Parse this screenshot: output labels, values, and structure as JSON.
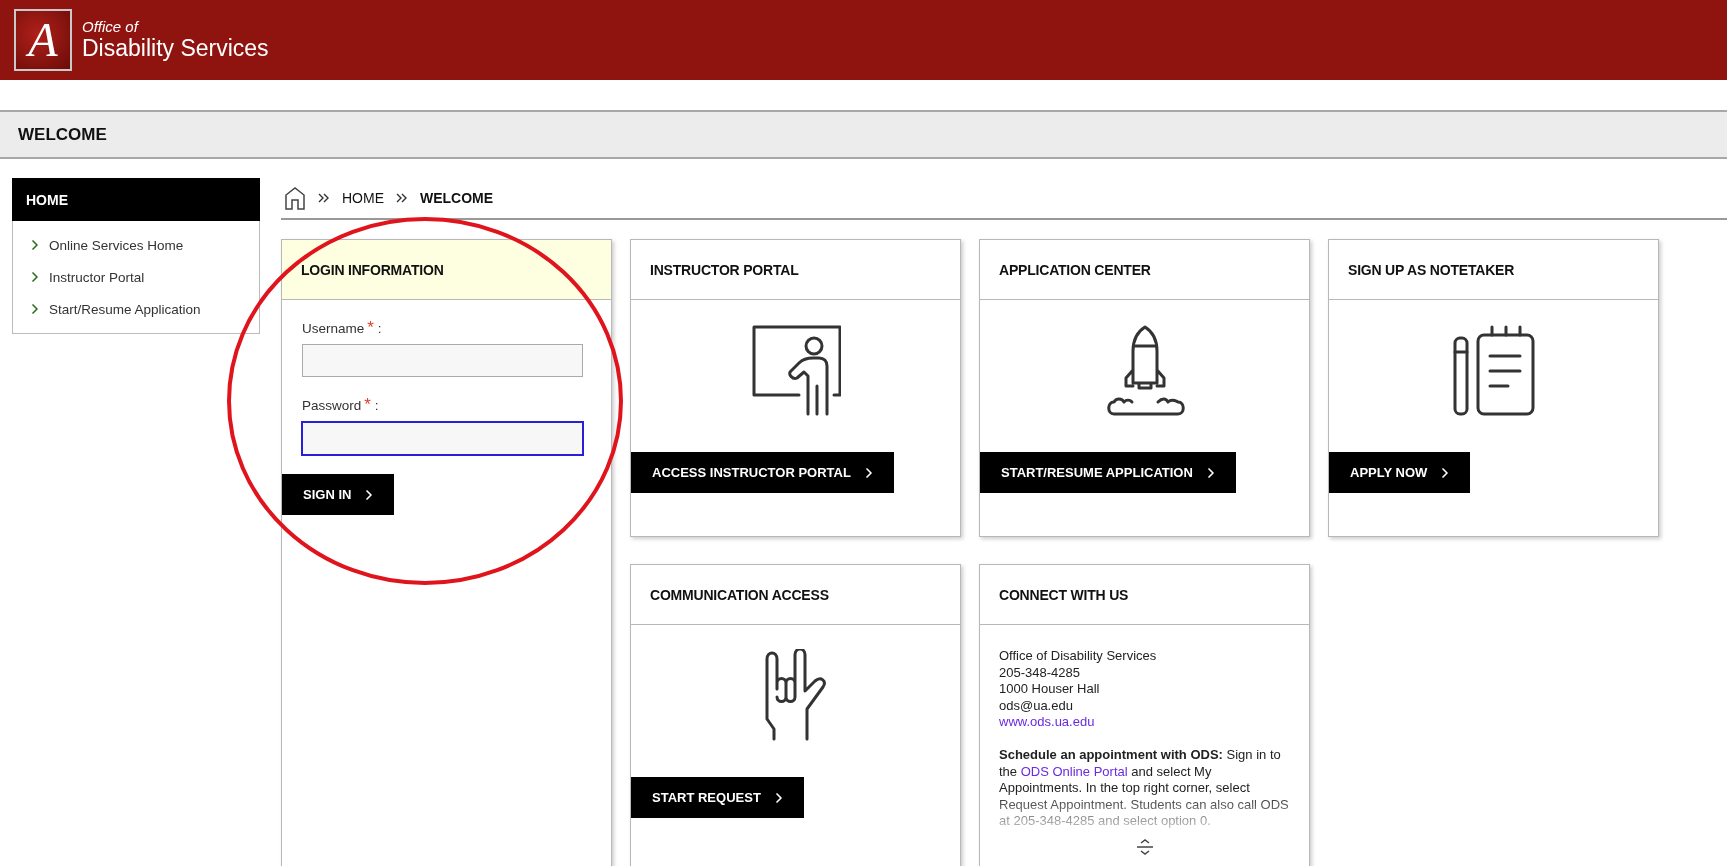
{
  "header": {
    "logo_letter": "A",
    "subtitle": "Office of",
    "title": "Disability Services"
  },
  "page_title": "WELCOME",
  "sidebar": {
    "heading": "HOME",
    "items": [
      {
        "label": "Online Services Home"
      },
      {
        "label": "Instructor Portal"
      },
      {
        "label": "Start/Resume Application"
      }
    ]
  },
  "breadcrumb": [
    {
      "label": "HOME",
      "current": false
    },
    {
      "label": "WELCOME",
      "current": true
    }
  ],
  "login": {
    "title": "LOGIN INFORMATION",
    "fields": [
      {
        "label": "Username",
        "required_mark": "*",
        "suffix": ":",
        "focused": false
      },
      {
        "label": "Password",
        "required_mark": "*",
        "suffix": ":",
        "focused": true
      }
    ],
    "button": "SIGN IN"
  },
  "cards": [
    {
      "title": "INSTRUCTOR PORTAL",
      "kind": "teacher",
      "button": "ACCESS INSTRUCTOR PORTAL"
    },
    {
      "title": "APPLICATION CENTER",
      "kind": "rocket",
      "button": "START/RESUME APPLICATION"
    },
    {
      "title": "SIGN UP AS NOTETAKER",
      "kind": "notepad",
      "button": "APPLY NOW"
    },
    {
      "title": "COMMUNICATION ACCESS",
      "kind": "hand",
      "button": "START REQUEST"
    }
  ],
  "connect": {
    "title": "CONNECT WITH US",
    "lines": [
      {
        "kind": "text",
        "text": "Office of Disability Services"
      },
      {
        "kind": "text",
        "text": "205-348-4285"
      },
      {
        "kind": "text",
        "text": "1000 Houser Hall"
      },
      {
        "kind": "text",
        "text": "ods@ua.edu"
      },
      {
        "kind": "link",
        "text": "www.ods.ua.edu"
      }
    ],
    "paragraph": [
      {
        "kind": "bold",
        "text": "Schedule an appointment with ODS:"
      },
      {
        "kind": "text",
        "text": " Sign in to the "
      },
      {
        "kind": "link",
        "text": "ODS Online Portal"
      },
      {
        "kind": "text",
        "text": " and select My Appointments. In the top right corner, select Request Appointment. Students can also call ODS at 205-348-4285 and select option 0."
      }
    ]
  }
}
